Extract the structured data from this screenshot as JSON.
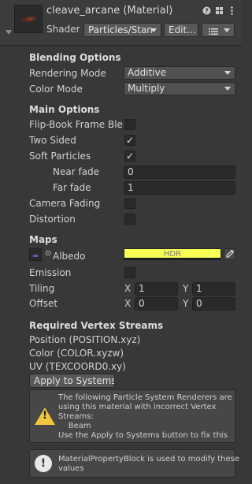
{
  "header": {
    "title": "cleave_arcane (Material)",
    "shader_label": "Shader",
    "shader_value": "Particles/Stan",
    "edit_label": "Edit...",
    "list_icon": "list-icon",
    "help_icon": "help-icon",
    "preset_icon": "preset-icon",
    "menu_icon": "kebab-menu-icon"
  },
  "blending": {
    "heading": "Blending Options",
    "rendering_mode_label": "Rendering Mode",
    "rendering_mode_value": "Additive",
    "color_mode_label": "Color Mode",
    "color_mode_value": "Multiply"
  },
  "main_options": {
    "heading": "Main Options",
    "flipbook_label": "Flip-Book Frame Blen",
    "flipbook_checked": false,
    "two_sided_label": "Two Sided",
    "two_sided_checked": true,
    "soft_particles_label": "Soft Particles",
    "soft_particles_checked": true,
    "near_fade_label": "Near fade",
    "near_fade_value": "0",
    "far_fade_label": "Far fade",
    "far_fade_value": "1",
    "camera_fading_label": "Camera Fading",
    "camera_fading_checked": false,
    "distortion_label": "Distortion",
    "distortion_checked": false
  },
  "maps": {
    "heading": "Maps",
    "albedo_label": "Albedo",
    "albedo_color": "#f8ff55",
    "albedo_hdr_label": "HDR",
    "emission_label": "Emission",
    "emission_checked": false,
    "tiling_label": "Tiling",
    "tiling_x": "1",
    "tiling_y": "1",
    "offset_label": "Offset",
    "offset_x": "0",
    "offset_y": "0",
    "x_label": "X",
    "y_label": "Y"
  },
  "vertex_streams": {
    "heading": "Required Vertex Streams",
    "streams": [
      "Position (POSITION.xyz)",
      "Color (COLOR.xyzw)",
      "UV (TEXCOORD0.xy)"
    ],
    "apply_button": "Apply to Systems"
  },
  "warning": {
    "lines": [
      "The following Particle System Renderers are",
      "using this material with incorrect Vertex",
      "Streams:",
      "    Beam",
      "Use the Apply to Systems button to fix this"
    ]
  },
  "info": {
    "lines": [
      "MaterialPropertyBlock is used to modify these",
      "values"
    ]
  }
}
